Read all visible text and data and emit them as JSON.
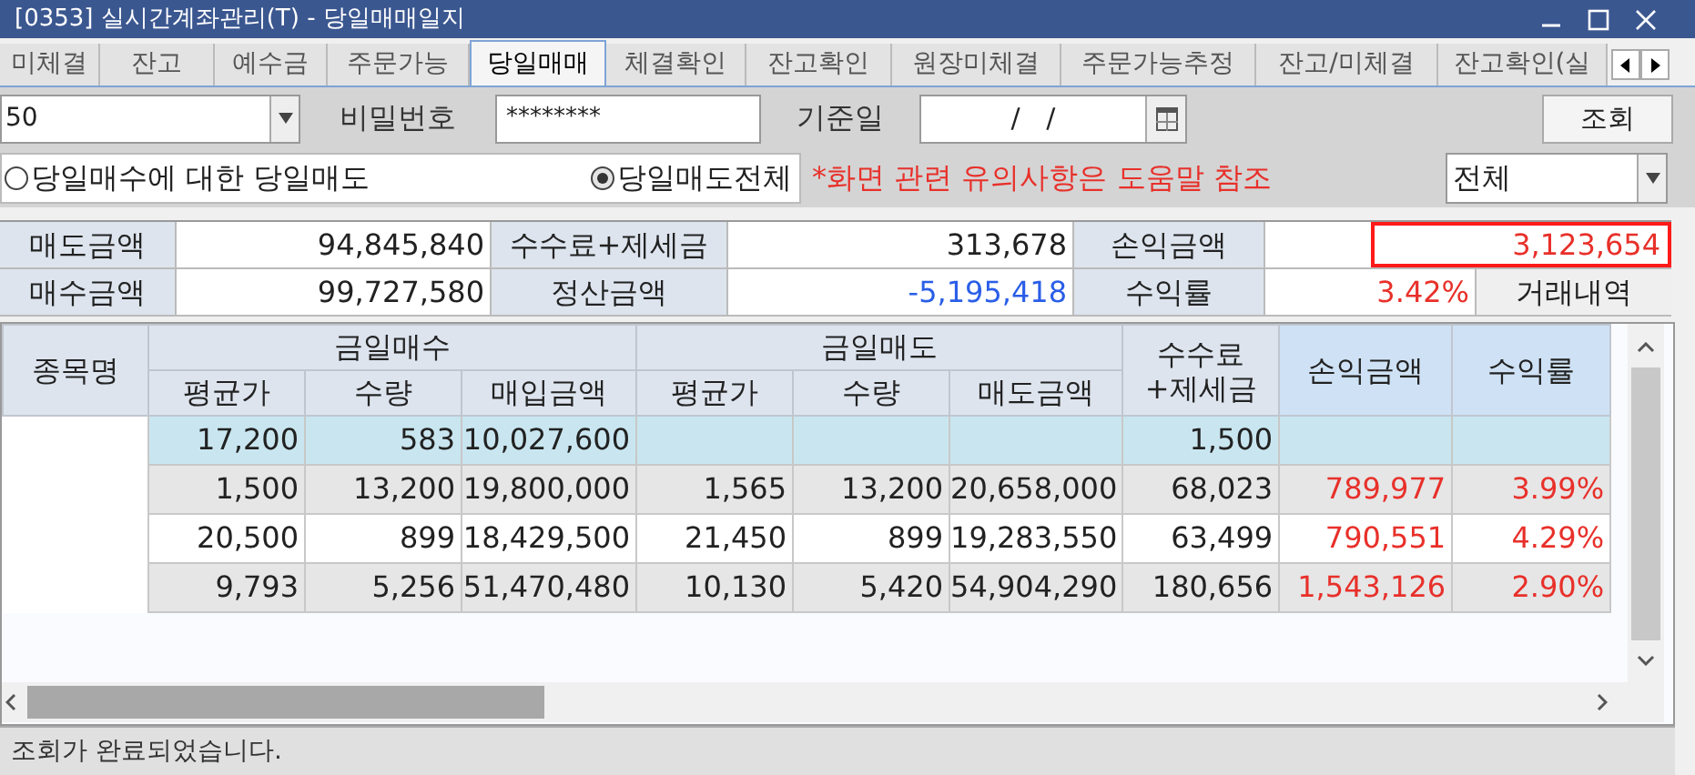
{
  "window": {
    "title": "[0353] 실시간계좌관리(T) - 당일매매일지"
  },
  "tabs": [
    {
      "label": "미체결",
      "selected": false
    },
    {
      "label": "잔고",
      "selected": false
    },
    {
      "label": "예수금",
      "selected": false
    },
    {
      "label": "주문가능",
      "selected": false
    },
    {
      "label": "당일매매",
      "selected": true
    },
    {
      "label": "체결확인",
      "selected": false
    },
    {
      "label": "잔고확인",
      "selected": false
    },
    {
      "label": "원장미체결",
      "selected": false
    },
    {
      "label": "주문가능추정",
      "selected": false
    },
    {
      "label": "잔고/미체결",
      "selected": false
    },
    {
      "label": "잔고확인(실",
      "selected": false
    }
  ],
  "query": {
    "account": "50",
    "password_label": "비밀번호",
    "password": "********",
    "date_label": "기준일",
    "date": "/ /",
    "search_button": "조회"
  },
  "options": [
    {
      "label": "당일매수에 대한 당일매도",
      "selected": false
    },
    {
      "label": "당일매도전체",
      "selected": true
    }
  ],
  "notice": "*화면 관련 유의사항은 도움말 참조",
  "filter": {
    "value": "전체"
  },
  "summary": [
    {
      "label": "매도금액",
      "value": "94,845,840",
      "label2": "수수료+제세금",
      "value2": "313,678",
      "value2_negative": false,
      "label3": "손익금액",
      "value3": "3,123,654",
      "highlighted": true
    },
    {
      "label": "매수금액",
      "value": "99,727,580",
      "label2": "정산금액",
      "value2": "-5,195,418",
      "value2_negative": true,
      "label3": "수익률",
      "value3": "3.42%",
      "highlighted": false,
      "button": "거래내역"
    }
  ],
  "table": {
    "name_header": "종목명",
    "buy_group": "금일매수",
    "sell_group": "금일매도",
    "buy_columns": [
      "평균가",
      "수량",
      "매입금액"
    ],
    "sell_columns": [
      "평균가",
      "수량",
      "매도금액"
    ],
    "fee_header": "수수료\n+제세금",
    "profit_header": "손익금액",
    "rate_header": "수익률",
    "rows": [
      {
        "selected": true,
        "cells": [
          "17,200",
          "583",
          "10,027,600",
          "",
          "",
          "",
          "1,500",
          "",
          ""
        ]
      },
      {
        "selected": false,
        "cells": [
          "1,500",
          "13,200",
          "19,800,000",
          "1,565",
          "13,200",
          "20,658,000",
          "68,023",
          "789,977",
          "3.99%"
        ]
      },
      {
        "selected": false,
        "cells": [
          "20,500",
          "899",
          "18,429,500",
          "21,450",
          "899",
          "19,283,550",
          "63,499",
          "790,551",
          "4.29%"
        ]
      },
      {
        "selected": false,
        "cells": [
          "9,793",
          "5,256",
          "51,470,480",
          "10,130",
          "5,420",
          "54,904,290",
          "180,656",
          "1,543,126",
          "2.90%"
        ]
      }
    ]
  },
  "status_bar": "조회가 완료되었습니다."
}
